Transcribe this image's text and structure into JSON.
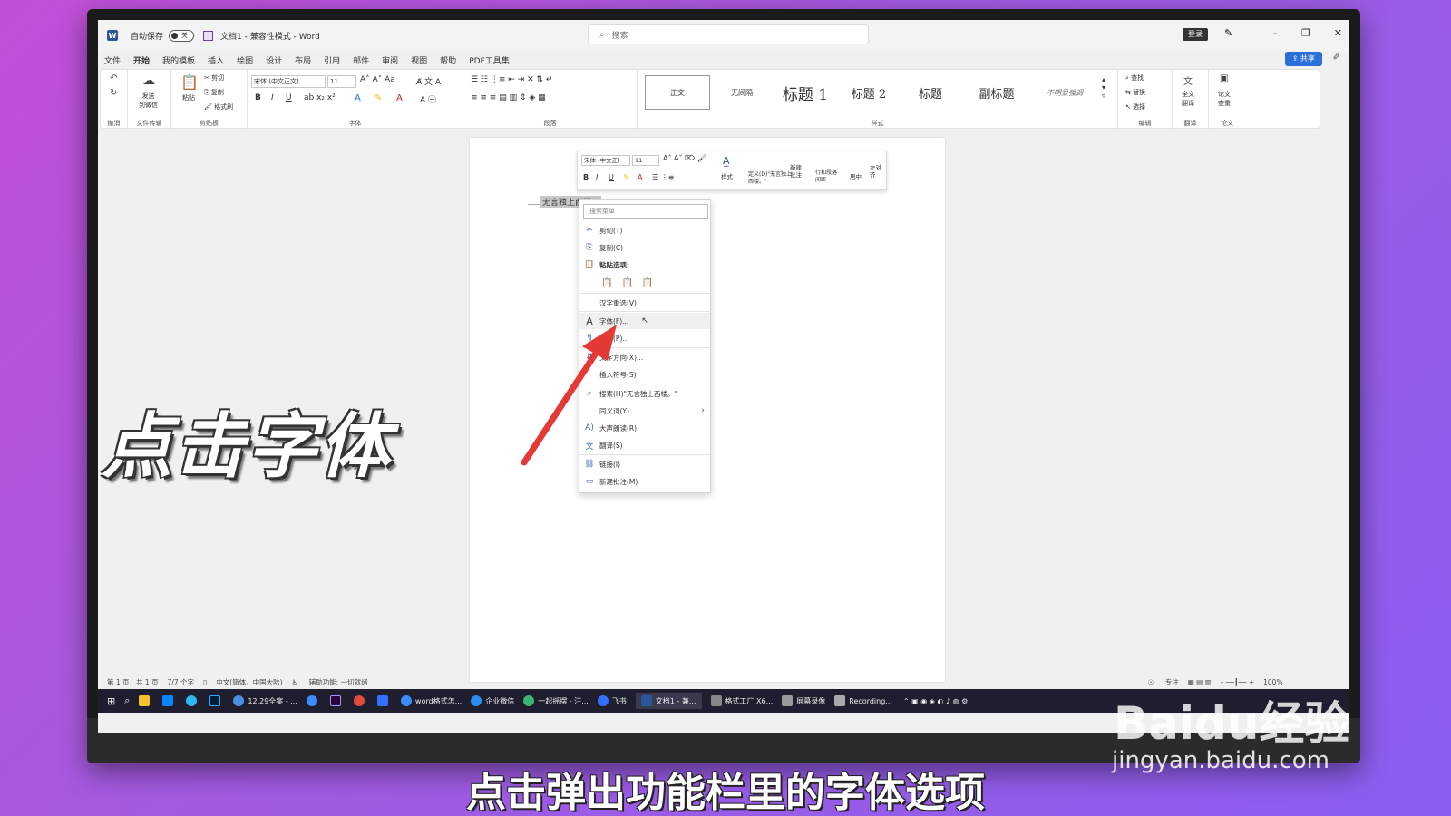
{
  "titlebar": {
    "autosave_label": "自动保存",
    "toggle_state": "关",
    "doc_title": "文档1 - 兼容性模式 - Word",
    "search_placeholder": "搜索",
    "login_label": "登录"
  },
  "menu": {
    "tabs": [
      "文件",
      "开始",
      "我的模板",
      "插入",
      "绘图",
      "设计",
      "布局",
      "引用",
      "邮件",
      "审阅",
      "视图",
      "帮助",
      "PDF工具集"
    ],
    "active_tab": "开始",
    "share_label": "共享"
  },
  "ribbon": {
    "groups": {
      "undo": "撤消",
      "file_transfer": "文件传输",
      "clipboard": "剪贴板",
      "font": "字体",
      "paragraph": "段落",
      "styles": "样式",
      "editing": "编辑",
      "translate": "翻译",
      "paper": "论文"
    },
    "send_wechat": "发送\n到微信",
    "paste": "粘贴",
    "cut": "剪切",
    "copy": "复制",
    "format_painter": "格式刷",
    "font_name": "宋体 (中文正文)",
    "font_size": "11",
    "styles": [
      "正文",
      "无间隔",
      "标题 1",
      "标题 2",
      "标题",
      "副标题",
      "不明显强调"
    ],
    "find": "查找",
    "replace": "替换",
    "select": "选择",
    "full_translate": "全文\n翻译",
    "paper_check": "论文\n查重"
  },
  "document": {
    "selected_text": "无言独上西楼。"
  },
  "mini_toolbar": {
    "font_name": "宋体 (中文正)",
    "font_size": "11",
    "styles": "样式",
    "define": "定义(D)\"无言独上西楼。\"",
    "new_comment": "新建\n批注",
    "line_spacing": "行和段落\n间距",
    "center": "居中",
    "align_left": "左对\n齐"
  },
  "context_menu": {
    "search_placeholder": "搜索菜单",
    "items": [
      {
        "label": "剪切(T)",
        "icon": "scissors-icon"
      },
      {
        "label": "复制(C)",
        "icon": "copy-icon"
      },
      {
        "label": "粘贴选项:",
        "icon": "paste-icon"
      },
      {
        "label": "汉字重选(V)",
        "icon": ""
      },
      {
        "label": "字体(F)...",
        "icon": "font-icon"
      },
      {
        "label": "段落(P)...",
        "icon": "paragraph-icon"
      },
      {
        "label": "文字方向(X)...",
        "icon": "text-direction-icon"
      },
      {
        "label": "插入符号(S)",
        "icon": ""
      },
      {
        "label": "搜索(H)\"无言独上西楼。\"",
        "icon": "search-icon"
      },
      {
        "label": "同义词(Y)",
        "icon": ""
      },
      {
        "label": "大声朗读(R)",
        "icon": "read-aloud-icon"
      },
      {
        "label": "翻译(S)",
        "icon": "translate-icon"
      },
      {
        "label": "链接(I)",
        "icon": "link-icon"
      },
      {
        "label": "新建批注(M)",
        "icon": "comment-icon"
      }
    ]
  },
  "statusbar": {
    "page": "第 1 页，共 1 页",
    "words": "7/7 个字",
    "language": "中文(简体，中国大陆)",
    "accessibility": "辅助功能: 一切就绪",
    "focus": "专注",
    "zoom": "100%"
  },
  "taskbar": {
    "items": [
      "12.29全案 - ...",
      "word格式怎...",
      "企业微信",
      "一起摇摆 - 汪...",
      "飞书",
      "文档1 - 兼...",
      "格式工厂 X6...",
      "屏幕录像",
      "Recording..."
    ],
    "active_item": "文档1 - 兼..."
  },
  "overlay": {
    "caption": "点击字体",
    "subtitle": "点击弹出功能栏里的字体选项",
    "watermark_brand": "Baidu经验",
    "watermark_url": "jingyan.baidu.com"
  },
  "colors": {
    "accent": "#2b579a",
    "arrow": "#e53935",
    "background_start": "#c14fd6",
    "background_end": "#8a5ef0"
  }
}
